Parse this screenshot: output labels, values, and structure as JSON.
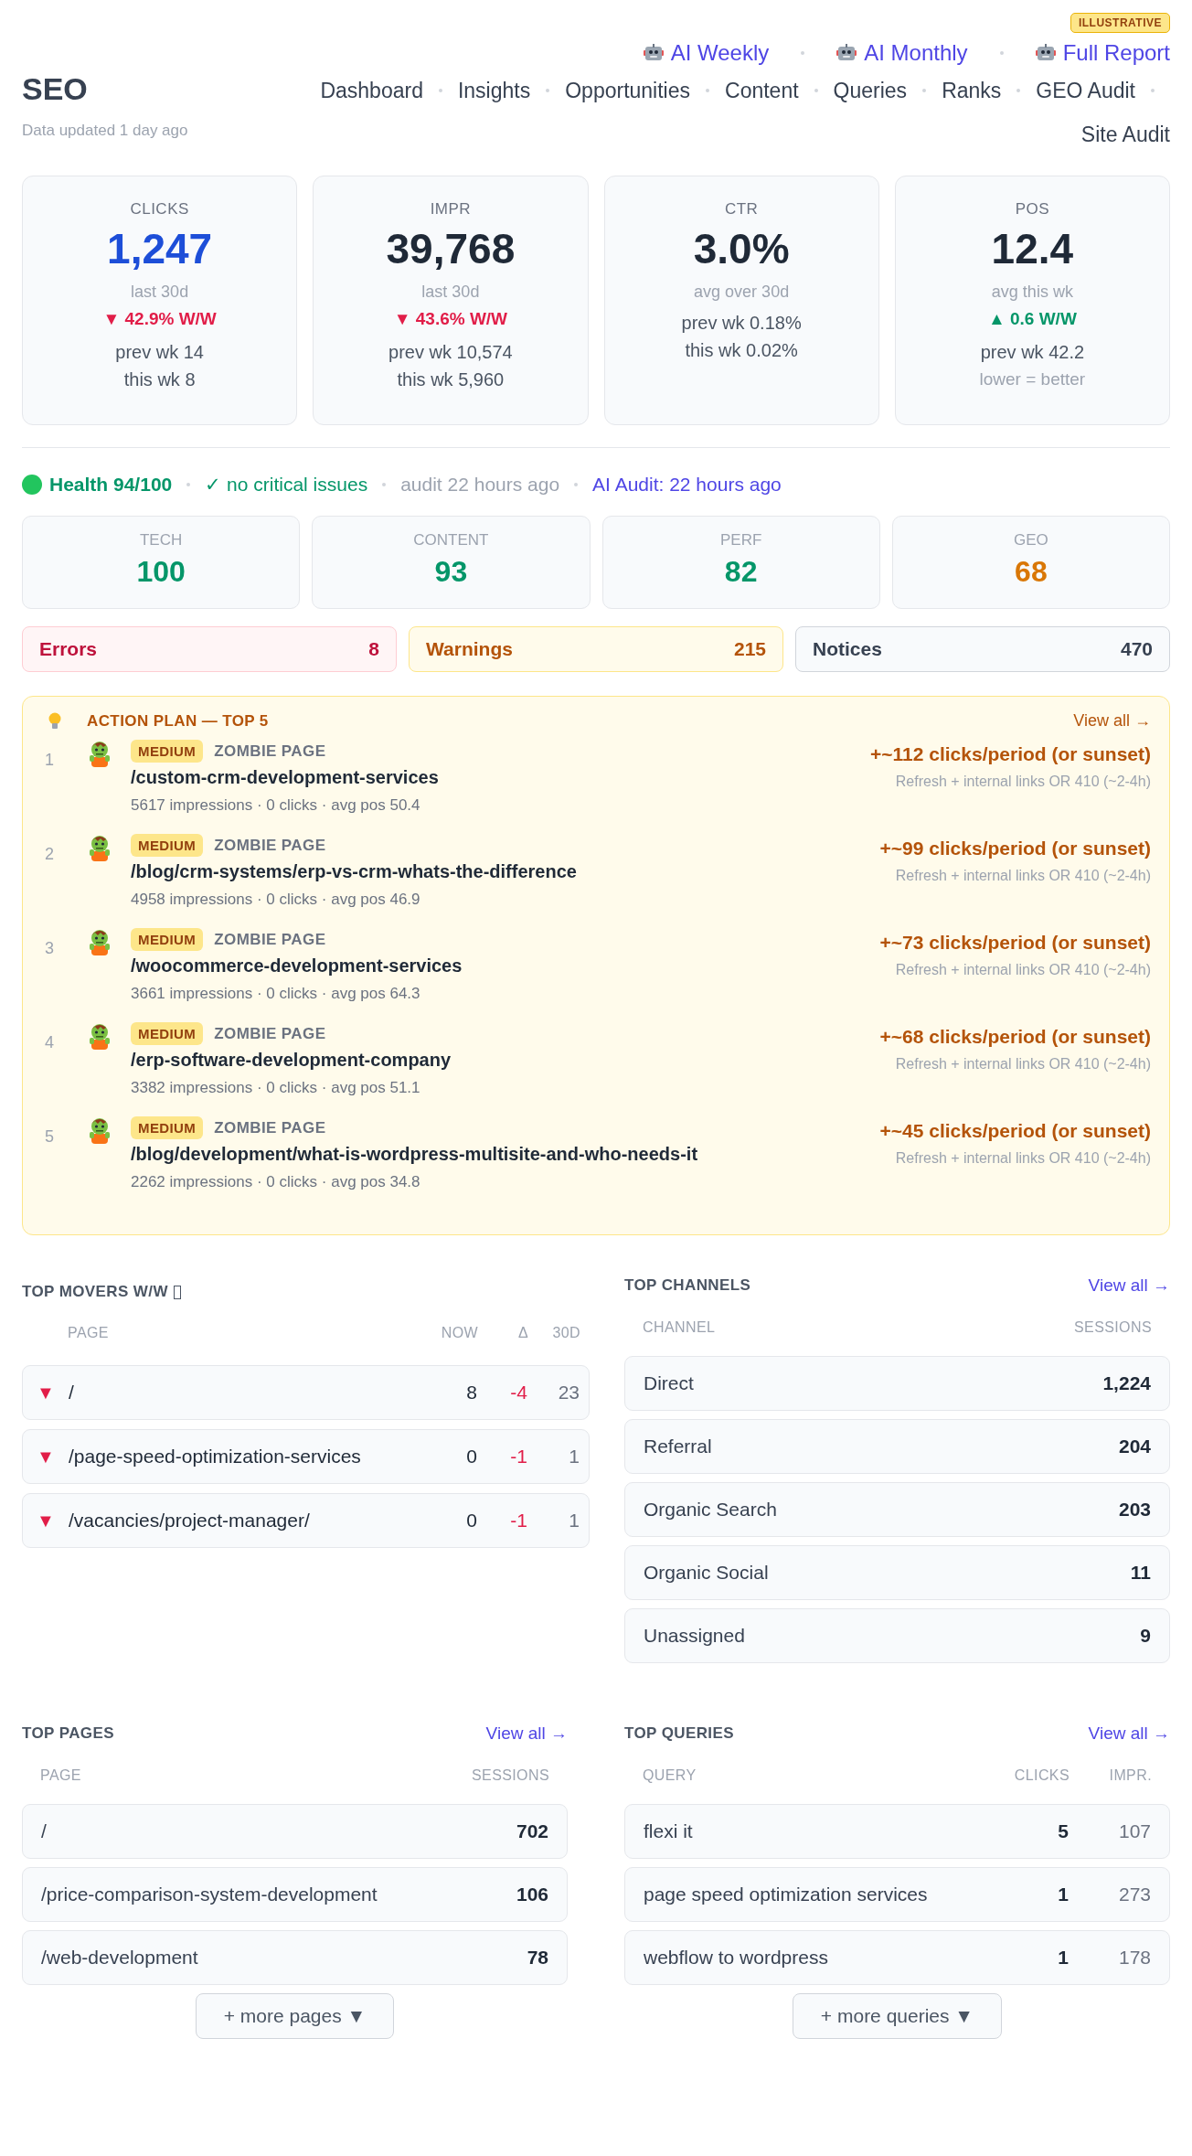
{
  "badge": "ILLUSTRATIVE",
  "header": {
    "title": "SEO",
    "subtitle": "Data updated 1 day ago",
    "report_links": [
      "AI Weekly",
      "AI Monthly",
      "Full Report"
    ],
    "nav": [
      "Dashboard",
      "Insights",
      "Opportunities",
      "Content",
      "Queries",
      "Ranks",
      "GEO Audit",
      "Site Audit"
    ]
  },
  "kpis": [
    {
      "label": "CLICKS",
      "value": "1,247",
      "accent": true,
      "rows": [
        {
          "kind": "period",
          "text": "last 30d"
        },
        {
          "kind": "down",
          "text": "▼ 42.9% W/W"
        },
        {
          "kind": "detail",
          "text": "prev wk 14"
        },
        {
          "kind": "detail",
          "text": "this wk 8"
        }
      ]
    },
    {
      "label": "IMPR",
      "value": "39,768",
      "accent": false,
      "rows": [
        {
          "kind": "period",
          "text": "last 30d"
        },
        {
          "kind": "down",
          "text": "▼ 43.6% W/W"
        },
        {
          "kind": "detail",
          "text": "prev wk 10,574"
        },
        {
          "kind": "detail",
          "text": "this wk 5,960"
        }
      ]
    },
    {
      "label": "CTR",
      "value": "3.0%",
      "accent": false,
      "rows": [
        {
          "kind": "period",
          "text": "avg over 30d"
        },
        {
          "kind": "detail",
          "text": "prev wk 0.18%"
        },
        {
          "kind": "detail",
          "text": "this wk 0.02%"
        }
      ]
    },
    {
      "label": "POS",
      "value": "12.4",
      "accent": false,
      "rows": [
        {
          "kind": "period",
          "text": "avg this wk"
        },
        {
          "kind": "up",
          "text": "▲ 0.6 W/W"
        },
        {
          "kind": "detail",
          "text": "prev wk 42.2"
        },
        {
          "kind": "note",
          "text": "lower = better"
        }
      ]
    }
  ],
  "health": {
    "score": "Health 94/100",
    "issues": "✓ no critical issues",
    "audit": "audit 22 hours ago",
    "ai_audit": "AI Audit: 22 hours ago"
  },
  "scores": [
    {
      "label": "TECH",
      "value": "100",
      "color": "#059669"
    },
    {
      "label": "CONTENT",
      "value": "93",
      "color": "#059669"
    },
    {
      "label": "PERF",
      "value": "82",
      "color": "#059669"
    },
    {
      "label": "GEO",
      "value": "68",
      "color": "#d97706"
    }
  ],
  "issues": [
    {
      "kind": "error",
      "label": "Errors",
      "count": "8"
    },
    {
      "kind": "warning",
      "label": "Warnings",
      "count": "215"
    },
    {
      "kind": "notice",
      "label": "Notices",
      "count": "470"
    }
  ],
  "action_plan": {
    "title": "ACTION PLAN — TOP 5",
    "view_all": "View all →",
    "items": [
      {
        "rank": "1",
        "priority": "MEDIUM",
        "type": "ZOMBIE PAGE",
        "path": "/custom-crm-development-services",
        "stats": "5617 impressions · 0 clicks · avg pos 50.4",
        "impact": "+~112 clicks/period (or sunset)",
        "fix": "Refresh + internal links OR 410 (~2-4h)"
      },
      {
        "rank": "2",
        "priority": "MEDIUM",
        "type": "ZOMBIE PAGE",
        "path": "/blog/crm-systems/erp-vs-crm-whats-the-difference",
        "stats": "4958 impressions · 0 clicks · avg pos 46.9",
        "impact": "+~99 clicks/period (or sunset)",
        "fix": "Refresh + internal links OR 410 (~2-4h)"
      },
      {
        "rank": "3",
        "priority": "MEDIUM",
        "type": "ZOMBIE PAGE",
        "path": "/woocommerce-development-services",
        "stats": "3661 impressions · 0 clicks · avg pos 64.3",
        "impact": "+~73 clicks/period (or sunset)",
        "fix": "Refresh + internal links OR 410 (~2-4h)"
      },
      {
        "rank": "4",
        "priority": "MEDIUM",
        "type": "ZOMBIE PAGE",
        "path": "/erp-software-development-company",
        "stats": "3382 impressions · 0 clicks · avg pos 51.1",
        "impact": "+~68 clicks/period (or sunset)",
        "fix": "Refresh + internal links OR 410 (~2-4h)"
      },
      {
        "rank": "5",
        "priority": "MEDIUM",
        "type": "ZOMBIE PAGE",
        "path": "/blog/development/what-is-wordpress-multisite-and-who-needs-it",
        "stats": "2262 impressions · 0 clicks · avg pos 34.8",
        "impact": "+~45 clicks/period (or sunset)",
        "fix": "Refresh + internal links OR 410 (~2-4h)"
      }
    ]
  },
  "top_movers": {
    "title": "TOP MOVERS W/W",
    "columns": [
      "PAGE",
      "NOW",
      "Δ",
      "30D"
    ],
    "rows": [
      {
        "trend": "▼",
        "page": "/",
        "now": "8",
        "delta": "-4",
        "last_30d": "23"
      },
      {
        "trend": "▼",
        "page": "/page-speed-optimization-services",
        "now": "0",
        "delta": "-1",
        "last_30d": "1"
      },
      {
        "trend": "▼",
        "page": "/vacancies/project-manager/",
        "now": "0",
        "delta": "-1",
        "last_30d": "1"
      }
    ]
  },
  "top_channels": {
    "title": "TOP CHANNELS",
    "view_all": "View all →",
    "columns": [
      "CHANNEL",
      "SESSIONS"
    ],
    "rows": [
      {
        "cells": [
          "Direct",
          "1,224"
        ]
      },
      {
        "cells": [
          "Referral",
          "204"
        ]
      },
      {
        "cells": [
          "Organic Search",
          "203"
        ]
      },
      {
        "cells": [
          "Organic Social",
          "11"
        ]
      },
      {
        "cells": [
          "Unassigned",
          "9"
        ]
      }
    ]
  },
  "top_pages": {
    "title": "TOP PAGES",
    "view_all": "View all →",
    "columns": [
      "PAGE",
      "SESSIONS"
    ],
    "rows": [
      {
        "cells": [
          "/",
          "702"
        ]
      },
      {
        "cells": [
          "/price-comparison-system-development",
          "106"
        ]
      },
      {
        "cells": [
          "/web-development",
          "78"
        ]
      }
    ],
    "more": "+ more pages ▼"
  },
  "top_queries": {
    "title": "TOP QUERIES",
    "view_all": "View all →",
    "columns": [
      "QUERY",
      "CLICKS",
      "IMPR."
    ],
    "rows": [
      {
        "cells": [
          "flexi it",
          "5",
          "107"
        ]
      },
      {
        "cells": [
          "page speed optimization services",
          "1",
          "273"
        ]
      },
      {
        "cells": [
          "webflow to wordpress",
          "1",
          "178"
        ]
      }
    ],
    "more": "+ more queries ▼"
  }
}
